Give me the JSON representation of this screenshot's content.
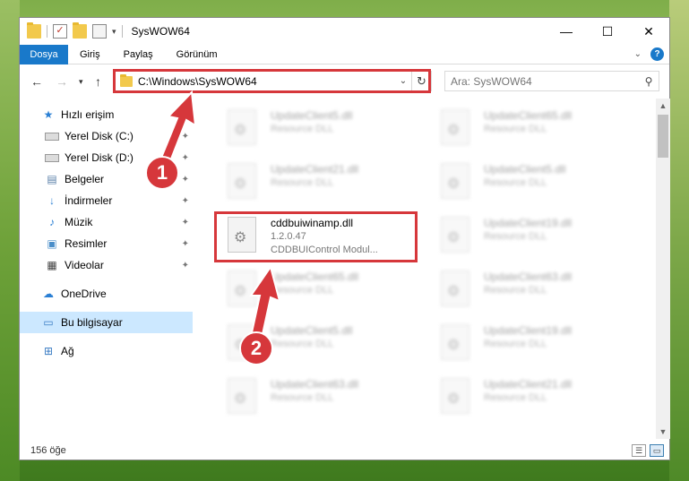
{
  "window": {
    "title": "SysWOW64",
    "buttons": {
      "minimize": "—",
      "maximize": "☐",
      "close": "✕"
    }
  },
  "ribbon": {
    "file_tab": "Dosya",
    "tabs": [
      "Giriş",
      "Paylaş",
      "Görünüm"
    ],
    "help": "?"
  },
  "address": {
    "path": "C:\\Windows\\SysWOW64",
    "search_placeholder": "Ara: SysWOW64"
  },
  "sidebar": {
    "items": [
      {
        "label": "Hızlı erişim",
        "icon": "star-icon",
        "pinned": false,
        "selected": false
      },
      {
        "label": "Yerel Disk (C:)",
        "icon": "disk-icon",
        "pinned": true,
        "selected": false
      },
      {
        "label": "Yerel Disk (D:)",
        "icon": "disk-icon",
        "pinned": true,
        "selected": false
      },
      {
        "label": "Belgeler",
        "icon": "documents-icon",
        "pinned": true,
        "selected": false
      },
      {
        "label": "İndirmeler",
        "icon": "download-icon",
        "pinned": true,
        "selected": false
      },
      {
        "label": "Müzik",
        "icon": "music-icon",
        "pinned": true,
        "selected": false
      },
      {
        "label": "Resimler",
        "icon": "pictures-icon",
        "pinned": true,
        "selected": false
      },
      {
        "label": "Videolar",
        "icon": "videos-icon",
        "pinned": true,
        "selected": false
      },
      {
        "label": "OneDrive",
        "icon": "cloud-icon",
        "pinned": false,
        "selected": false
      },
      {
        "label": "Bu bilgisayar",
        "icon": "computer-icon",
        "pinned": false,
        "selected": true
      },
      {
        "label": "Ağ",
        "icon": "network-icon",
        "pinned": false,
        "selected": false
      }
    ]
  },
  "files": [
    {
      "name": "UpdateClient5.dll",
      "desc": "Resource DLL",
      "blurred": true
    },
    {
      "name": "UpdateClient65.dll",
      "desc": "Resource DLL",
      "blurred": true
    },
    {
      "name": "UpdateClient21.dll",
      "desc": "Resource DLL",
      "blurred": true
    },
    {
      "name": "UpdateClient5.dll",
      "desc": "Resource DLL",
      "blurred": true
    },
    {
      "name": "cddbuiwinamp.dll",
      "version": "1.2.0.47",
      "desc": "CDDBUIControl Modul...",
      "blurred": false
    },
    {
      "name": "UpdateClient19.dll",
      "desc": "Resource DLL",
      "blurred": true
    },
    {
      "name": "UpdateClient65.dll",
      "desc": "Resource DLL",
      "blurred": true
    },
    {
      "name": "UpdateClient63.dll",
      "desc": "Resource DLL",
      "blurred": true
    },
    {
      "name": "UpdateClient5.dll",
      "desc": "Resource DLL",
      "blurred": true
    },
    {
      "name": "UpdateClient19.dll",
      "desc": "Resource DLL",
      "blurred": true
    },
    {
      "name": "UpdateClient63.dll",
      "desc": "Resource DLL",
      "blurred": true
    },
    {
      "name": "UpdateClient21.dll",
      "desc": "Resource DLL",
      "blurred": true
    }
  ],
  "status": {
    "item_count": "156 öğe"
  },
  "annotations": {
    "step1": "1",
    "step2": "2"
  },
  "colors": {
    "accent": "#1979ca",
    "highlight": "#d6373b",
    "selected": "#cce8ff"
  }
}
